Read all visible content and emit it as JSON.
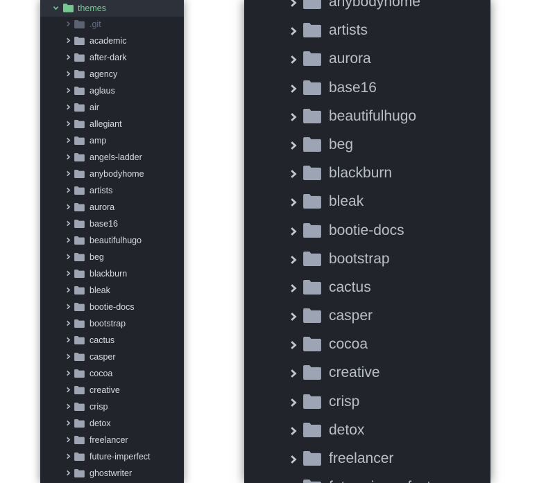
{
  "small_tree": {
    "root": {
      "label": "themes",
      "expanded": true
    },
    "items": [
      {
        "label": ".git",
        "ignored": true
      },
      {
        "label": "academic"
      },
      {
        "label": "after-dark"
      },
      {
        "label": "agency"
      },
      {
        "label": "aglaus"
      },
      {
        "label": "air"
      },
      {
        "label": "allegiant"
      },
      {
        "label": "amp"
      },
      {
        "label": "angels-ladder"
      },
      {
        "label": "anybodyhome"
      },
      {
        "label": "artists"
      },
      {
        "label": "aurora"
      },
      {
        "label": "base16"
      },
      {
        "label": "beautifulhugo"
      },
      {
        "label": "beg"
      },
      {
        "label": "blackburn"
      },
      {
        "label": "bleak"
      },
      {
        "label": "bootie-docs"
      },
      {
        "label": "bootstrap"
      },
      {
        "label": "cactus"
      },
      {
        "label": "casper"
      },
      {
        "label": "cocoa"
      },
      {
        "label": "creative"
      },
      {
        "label": "crisp"
      },
      {
        "label": "detox"
      },
      {
        "label": "freelancer"
      },
      {
        "label": "future-imperfect"
      },
      {
        "label": "ghostwriter"
      }
    ]
  },
  "zoomed_tree": {
    "items": [
      {
        "label": "anybodyhome"
      },
      {
        "label": "artists"
      },
      {
        "label": "aurora"
      },
      {
        "label": "base16"
      },
      {
        "label": "beautifulhugo"
      },
      {
        "label": "beg"
      },
      {
        "label": "blackburn"
      },
      {
        "label": "bleak"
      },
      {
        "label": "bootie-docs"
      },
      {
        "label": "bootstrap"
      },
      {
        "label": "cactus"
      },
      {
        "label": "casper"
      },
      {
        "label": "cocoa"
      },
      {
        "label": "creative"
      },
      {
        "label": "crisp"
      },
      {
        "label": "detox"
      },
      {
        "label": "freelancer"
      },
      {
        "label": "future-imperfect"
      }
    ]
  },
  "icons": {
    "collapsed": "chevron-right-icon",
    "expanded": "chevron-down-icon",
    "folder": "folder-icon"
  },
  "colors": {
    "panel_bg": "#21252b",
    "selected_row_bg": "#2c313a",
    "text": "#d7dae0",
    "zoom_text": "#b9bec7",
    "added_green": "#73c990",
    "ignored_text": "#636d83",
    "folder_icon": "#9da5b4"
  }
}
